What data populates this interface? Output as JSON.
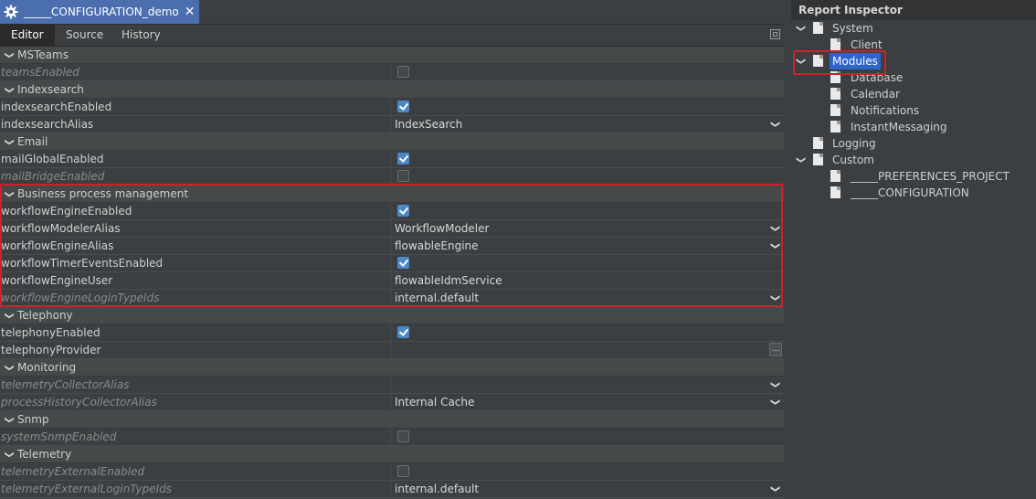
{
  "document_tab": {
    "title": "_____CONFIGURATION_demo",
    "close": "✕"
  },
  "sub_tabs": [
    "Editor",
    "Source",
    "History"
  ],
  "sections": [
    {
      "label": "MSTeams",
      "rows": [
        {
          "name": "teamsEnabled",
          "italic": true,
          "type": "checkbox",
          "checked": false
        }
      ]
    },
    {
      "label": "Indexsearch",
      "rows": [
        {
          "name": "indexsearchEnabled",
          "italic": false,
          "type": "checkbox",
          "checked": true
        },
        {
          "name": "indexsearchAlias",
          "italic": false,
          "type": "dropdown",
          "value": "IndexSearch"
        }
      ]
    },
    {
      "label": "Email",
      "rows": [
        {
          "name": "mailGlobalEnabled",
          "italic": false,
          "type": "checkbox",
          "checked": true
        },
        {
          "name": "mailBridgeEnabled",
          "italic": true,
          "type": "checkbox",
          "checked": false
        }
      ]
    },
    {
      "label": "Business process management",
      "rows": [
        {
          "name": "workflowEngineEnabled",
          "italic": false,
          "type": "checkbox",
          "checked": true
        },
        {
          "name": "workflowModelerAlias",
          "italic": false,
          "type": "dropdown",
          "value": "WorkflowModeler"
        },
        {
          "name": "workflowEngineAlias",
          "italic": false,
          "type": "dropdown",
          "value": "flowableEngine"
        },
        {
          "name": "workflowTimerEventsEnabled",
          "italic": false,
          "type": "checkbox",
          "checked": true
        },
        {
          "name": "workflowEngineUser",
          "italic": false,
          "type": "text",
          "value": "flowableIdmService"
        },
        {
          "name": "workflowEngineLoginTypeIds",
          "italic": true,
          "type": "dropdown",
          "value": "internal.default"
        }
      ]
    },
    {
      "label": "Telephony",
      "rows": [
        {
          "name": "telephonyEnabled",
          "italic": false,
          "type": "checkbox",
          "checked": true
        },
        {
          "name": "telephonyProvider",
          "italic": false,
          "type": "ellipsis",
          "value": "",
          "button": "..."
        }
      ]
    },
    {
      "label": "Monitoring",
      "rows": [
        {
          "name": "telemetryCollectorAlias",
          "italic": true,
          "type": "dropdown",
          "value": ""
        },
        {
          "name": "processHistoryCollectorAlias",
          "italic": true,
          "type": "dropdown",
          "value": "Internal Cache"
        }
      ]
    },
    {
      "label": "Snmp",
      "rows": [
        {
          "name": "systemSnmpEnabled",
          "italic": true,
          "type": "checkbox",
          "checked": false
        }
      ]
    },
    {
      "label": "Telemetry",
      "rows": [
        {
          "name": "telemetryExternalEnabled",
          "italic": true,
          "type": "checkbox",
          "checked": false
        },
        {
          "name": "telemetryExternalLoginTypeIds",
          "italic": true,
          "type": "dropdown",
          "value": "internal.default"
        }
      ]
    }
  ],
  "inspector": {
    "title": "Report Inspector",
    "tree": [
      {
        "label": "System",
        "level": 0,
        "expanded": true,
        "selected": false
      },
      {
        "label": "Client",
        "level": 1,
        "selected": false
      },
      {
        "label": "Modules",
        "level": 0,
        "expanded": true,
        "selected": true
      },
      {
        "label": "Database",
        "level": 1,
        "selected": false
      },
      {
        "label": "Calendar",
        "level": 1,
        "selected": false
      },
      {
        "label": "Notifications",
        "level": 1,
        "selected": false
      },
      {
        "label": "InstantMessaging",
        "level": 1,
        "selected": false
      },
      {
        "label": "Logging",
        "level": 0,
        "selected": false
      },
      {
        "label": "Custom",
        "level": 0,
        "expanded": true,
        "selected": false
      },
      {
        "label": "_____PREFERENCES_PROJECT",
        "level": 1,
        "selected": false
      },
      {
        "label": "_____CONFIGURATION",
        "level": 1,
        "selected": false
      }
    ]
  },
  "colors": {
    "accent": "#4a88c7",
    "selection": "#2f65ca",
    "highlight": "#d0202a",
    "tab": "#4b6eaf"
  }
}
